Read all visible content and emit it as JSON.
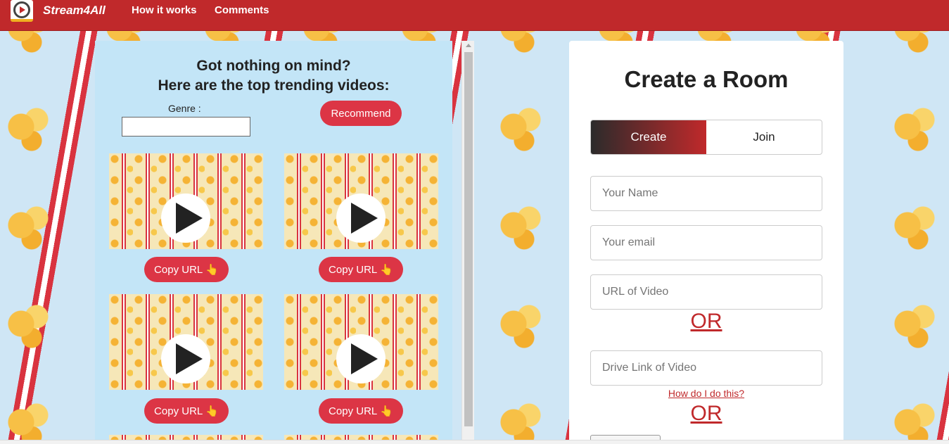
{
  "navbar": {
    "brand": "Stream4All",
    "links": [
      "How it works",
      "Comments"
    ]
  },
  "trending": {
    "title_line1": "Got nothing on mind?",
    "title_line2": "Here are the top trending videos:",
    "genre_label": "Genre :",
    "genre_value": "",
    "recommend_label": "Recommend",
    "copy_label": "Copy URL",
    "hand_icon": "👆"
  },
  "room": {
    "title": "Create a Room",
    "tab_create": "Create",
    "tab_join": "Join",
    "name_placeholder": "Your Name",
    "email_placeholder": "Your email",
    "url_placeholder": "URL of Video",
    "or_label": "OR",
    "drive_placeholder": "Drive Link of Video",
    "howto_label": "How do I do this?"
  },
  "colors": {
    "nav": "#c0292b",
    "button": "#dc3545",
    "panel": "#c3e5f7"
  }
}
